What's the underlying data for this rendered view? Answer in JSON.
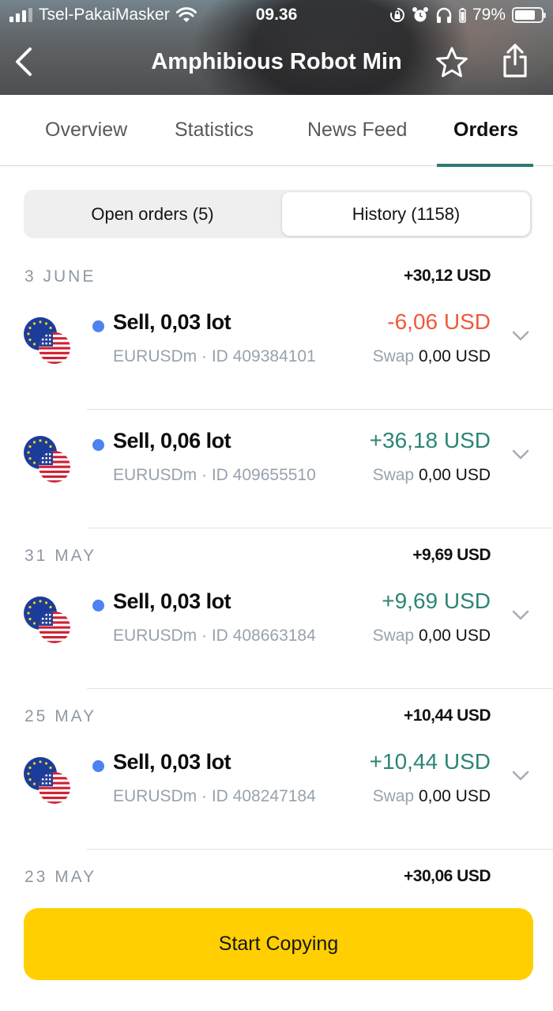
{
  "status_bar": {
    "carrier": "Tsel-PakaiMasker",
    "time": "09.36",
    "battery": "79%",
    "battery_level": 0.79,
    "signal_bars": 3,
    "icons": [
      "signal-icon",
      "wifi-icon",
      "rotation-lock-icon",
      "alarm-icon",
      "headphones-icon",
      "battery-icon"
    ]
  },
  "nav": {
    "title": "Amphibious Robot Min",
    "back_icon": "chevron-left-icon",
    "favorite_icon": "star-icon",
    "share_icon": "share-icon"
  },
  "tabs": [
    {
      "label": "Overview",
      "active": false
    },
    {
      "label": "Statistics",
      "active": false
    },
    {
      "label": "News Feed",
      "active": false
    },
    {
      "label": "Orders",
      "active": true
    }
  ],
  "segments": {
    "open": "Open orders (5)",
    "history": "History (1158)",
    "selected": "history"
  },
  "groups": [
    {
      "date": "3 JUNE",
      "total": "+30,12 USD",
      "orders": [
        {
          "side": "Sell, 0,03 lot",
          "symbol": "EURUSDm",
          "id": "ID 409384101",
          "profit": "-6,06 USD",
          "profit_sign": "neg",
          "swap_label": "Swap",
          "swap": "0,00 USD"
        },
        {
          "side": "Sell, 0,06 lot",
          "symbol": "EURUSDm",
          "id": "ID 409655510",
          "profit": "+36,18 USD",
          "profit_sign": "pos",
          "swap_label": "Swap",
          "swap": "0,00 USD"
        }
      ]
    },
    {
      "date": "31 MAY",
      "total": "+9,69 USD",
      "orders": [
        {
          "side": "Sell, 0,03 lot",
          "symbol": "EURUSDm",
          "id": "ID 408663184",
          "profit": "+9,69 USD",
          "profit_sign": "pos",
          "swap_label": "Swap",
          "swap": "0,00 USD"
        }
      ]
    },
    {
      "date": "25 MAY",
      "total": "+10,44 USD",
      "orders": [
        {
          "side": "Sell, 0,03 lot",
          "symbol": "EURUSDm",
          "id": "ID 408247184",
          "profit": "+10,44 USD",
          "profit_sign": "pos",
          "swap_label": "Swap",
          "swap": "0,00 USD"
        }
      ]
    },
    {
      "date": "23 MAY",
      "total": "+30,06 USD",
      "orders": []
    }
  ],
  "cta": {
    "label": "Start Copying"
  },
  "colors": {
    "accent_teal": "#2c7a73",
    "profit_positive": "#2c8577",
    "profit_negative": "#ee5a3a",
    "status_dot": "#4c82f1",
    "cta_yellow": "#ffcf02"
  }
}
